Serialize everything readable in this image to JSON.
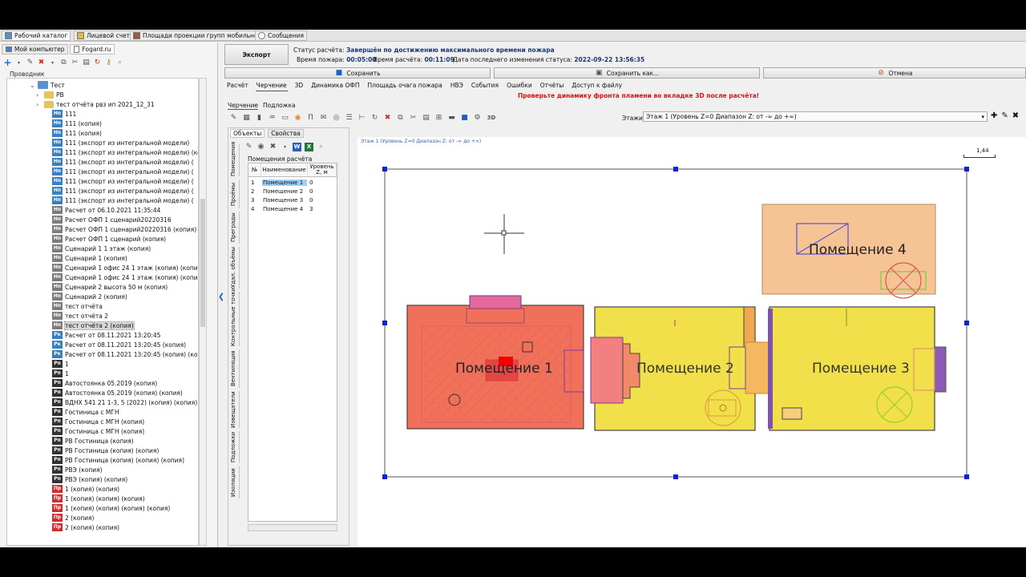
{
  "top_tabs": [
    {
      "label": "Рабочий каталог"
    },
    {
      "label": "Лицевой счет"
    },
    {
      "label": "Площади проекции групп мобильности"
    },
    {
      "label": "Сообщения"
    }
  ],
  "left_panel": {
    "tabs": [
      {
        "label": "Мой компьютер"
      },
      {
        "label": "Fogard.ru"
      }
    ],
    "explorer_label": "Проводник",
    "tree": [
      {
        "label": "Тест",
        "icon": "folder"
      },
      {
        "label": "РВ",
        "icon": "folder"
      },
      {
        "label": "тест отчёта рвз ип 2021_12_31",
        "icon": "folder"
      },
      {
        "label": "111",
        "icon": "Нп"
      },
      {
        "label": "111 (копия)",
        "icon": "Нп"
      },
      {
        "label": "111 (копия)",
        "icon": "Нп"
      },
      {
        "label": "111 (экспорт из интегральной модели)",
        "icon": "Нп"
      },
      {
        "label": "111 (экспорт из интегральной модели) (копия)",
        "icon": "Нп"
      },
      {
        "label": "111 (экспорт из интегральной модели) (",
        "icon": "Нп"
      },
      {
        "label": "111 (экспорт из интегральной модели) (",
        "icon": "Нп"
      },
      {
        "label": "111 (экспорт из интегральной модели) (",
        "icon": "Нп"
      },
      {
        "label": "111 (экспорт из интегральной модели) (",
        "icon": "Нп"
      },
      {
        "label": "111 (экспорт из интегральной модели) (",
        "icon": "Нп"
      },
      {
        "label": "Расчет от 06.10.2021 11:35:44",
        "icon": "Нп-g"
      },
      {
        "label": "Расчет ОФП 1 сценарий20220316",
        "icon": "Нп-g"
      },
      {
        "label": "Расчет ОФП 1 сценарий20220316 (копия)",
        "icon": "Нп-g"
      },
      {
        "label": "Расчет ОФП 1 сценарий (копия)",
        "icon": "Нп-g"
      },
      {
        "label": "Сценарий 1 1 этаж (копия)",
        "icon": "Нп-g"
      },
      {
        "label": "Сценарий 1 (копия)",
        "icon": "Нп-g"
      },
      {
        "label": "Сценарий 1 офис 24 1 этаж (копия) (копия)",
        "icon": "Нп-g"
      },
      {
        "label": "Сценарий 1 офис 24 1 этаж (копия) (копия)",
        "icon": "Нп-g"
      },
      {
        "label": "Сценарий 2 высота 50 м (копия)",
        "icon": "Нп-g"
      },
      {
        "label": "Сценарий 2 (копия)",
        "icon": "Нп-g"
      },
      {
        "label": "тест отчёта",
        "icon": "Нп-g"
      },
      {
        "label": "тест отчёта 2",
        "icon": "Нп-g"
      },
      {
        "label": "тест отчёта 2 (копия)",
        "icon": "Нп-g",
        "selected": true
      },
      {
        "label": "Расчет от 08.11.2021 13:20:45",
        "icon": "Рк"
      },
      {
        "label": "Расчет от 08.11.2021 13:20:45 (копия)",
        "icon": "Рк"
      },
      {
        "label": "Расчет от 08.11.2021 13:20:45 (копия) (копия)",
        "icon": "Рк"
      },
      {
        "label": "1",
        "icon": "Рп"
      },
      {
        "label": "1",
        "icon": "Рп"
      },
      {
        "label": "Автостоянка 05.2019 (копия)",
        "icon": "Рп"
      },
      {
        "label": "Автостоянка 05.2019 (копия) (копия)",
        "icon": "Рп"
      },
      {
        "label": "ВДНХ 541 21 1-3, 5 (2022) (копия) (копия) (копия)",
        "icon": "Рп"
      },
      {
        "label": "Гостиница с МГН",
        "icon": "Рп"
      },
      {
        "label": "Гостиница с МГН (копия)",
        "icon": "Рп"
      },
      {
        "label": "Гостиница с МГН (копия)",
        "icon": "Рп"
      },
      {
        "label": "РВ Гостиница (копия)",
        "icon": "Рп"
      },
      {
        "label": "РВ Гостиница (копия) (копия)",
        "icon": "Рп"
      },
      {
        "label": "РВ Гостиница (копия) (копия) (копия)",
        "icon": "Рп"
      },
      {
        "label": "РВЭ (копия)",
        "icon": "Рп"
      },
      {
        "label": "РВЭ (копия) (копия)",
        "icon": "Рп"
      },
      {
        "label": "1 (копия) (копия)",
        "icon": "Пр"
      },
      {
        "label": "1 (копия) (копия) (копия)",
        "icon": "Пр"
      },
      {
        "label": "1 (копия) (копия) (копия) (копия)",
        "icon": "Пр"
      },
      {
        "label": "2 (копия)",
        "icon": "Пр"
      },
      {
        "label": "2 (копия) (копия)",
        "icon": "Пр"
      }
    ]
  },
  "right_panel": {
    "export_label": "Экспорт",
    "status": {
      "label": "Статус расчёта:",
      "value": "Завершён по достижению максимального времени пожара",
      "fire_time_label": "Время пожара:",
      "fire_time": "00:05:00",
      "calc_time_label": "Время расчёта:",
      "calc_time": "00:11:09",
      "last_change_label": "Дата последнего изменения статуса:",
      "last_change": "2022-09-22 13:56:35"
    },
    "buttons": {
      "save": "Сохранить",
      "save_as": "Сохранить как...",
      "cancel": "Отмена"
    },
    "tabs": [
      "Расчёт",
      "Черчение",
      "3D",
      "Динамика ОФП",
      "Площадь очага пожара",
      "НВЭ",
      "События",
      "Ошибки",
      "Отчёты",
      "Доступ к файлу"
    ],
    "warning": "Проверьте динамику фронта пламени во вкладке 3D после расчёта!",
    "drawing_tabs": [
      "Черчение",
      "Подложка"
    ],
    "floors_label": "Этажи:",
    "floor_value": "Этаж 1 (Уровень Z=0 Диапазон Z: от -∞ до +∞)",
    "objects": {
      "tabs": [
        "Объекты",
        "Свойства"
      ],
      "vertical_tabs": [
        "Помещения",
        "Проёмы",
        "Преграды",
        "Удал. объёмы",
        "Контрольные точки",
        "Вентиляция",
        "Извещатели",
        "Подложки",
        "Изоляции"
      ],
      "title": "Помещения расчёта",
      "columns": [
        "№",
        "Наименование",
        "Уровень Z, м"
      ],
      "rows": [
        {
          "n": "1",
          "name": "Помещение 1",
          "z": "0"
        },
        {
          "n": "2",
          "name": "Помещение 2",
          "z": "0"
        },
        {
          "n": "3",
          "name": "Помещение 3",
          "z": "0"
        },
        {
          "n": "4",
          "name": "Помещение 4",
          "z": "3"
        }
      ]
    },
    "canvas": {
      "title": "Этаж 1 (Уровень Z=0 Диапазон Z: от -∞ до +∞)",
      "scale_label": "1,44",
      "room_labels": [
        "Помещение 1",
        "Помещение 2",
        "Помещение 3",
        "Помещение 4"
      ]
    }
  },
  "colors": {
    "room_hot": "#f0705a",
    "room_warm": "#f2e04a",
    "room_cool": "#f6c394",
    "selection": "#0a16d6",
    "warning": "#e01010"
  }
}
